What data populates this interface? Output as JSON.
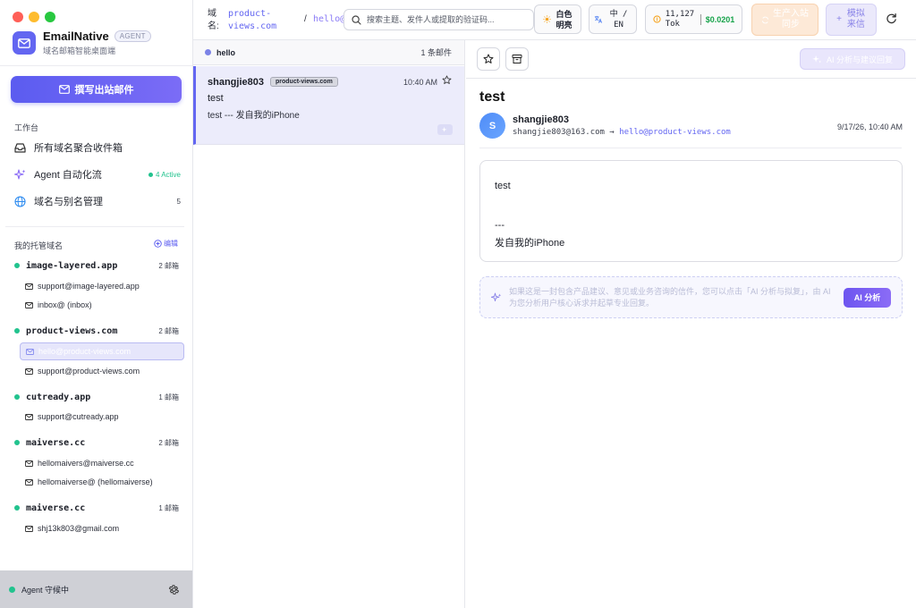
{
  "app": {
    "name": "EmailNative",
    "badge": "AGENT",
    "subtitle": "域名邮箱智能桌面端"
  },
  "sidebar": {
    "compose_label": "撰写出站邮件",
    "workspace_label": "工作台",
    "nav": [
      {
        "label": "所有域名聚合收件箱",
        "icon": "inbox-icon"
      },
      {
        "label": "Agent 自动化流",
        "icon": "sparkles-icon",
        "status": "4 Active"
      },
      {
        "label": "域名与别名管理",
        "icon": "globe-icon",
        "count": "5"
      }
    ],
    "domains_label": "我的托管域名",
    "edit_label": "编辑",
    "domains": [
      {
        "name": "image-layered.app",
        "count": "2 邮箱",
        "boxes": [
          "support@image-layered.app",
          "inbox@ (inbox)"
        ]
      },
      {
        "name": "product-views.com",
        "count": "2 邮箱",
        "boxes": [
          "hello@product-views.com",
          "support@product-views.com"
        ]
      },
      {
        "name": "cutready.app",
        "count": "1 邮箱",
        "boxes": [
          "support@cutready.app"
        ]
      },
      {
        "name": "maiverse.cc",
        "count": "2 邮箱",
        "boxes": [
          "hellomaivers@maiverse.cc",
          "hellomaiverse@ (hellomaiverse)"
        ]
      },
      {
        "name": "maiverse.cc",
        "count": "1 邮箱",
        "boxes": [
          "shj13k803@gmail.com"
        ]
      }
    ],
    "footer_status": "Agent 守候中"
  },
  "topbar": {
    "domain_label": "域名:",
    "domain_value": "product-views.com",
    "separator": "/",
    "mailbox": "hello@",
    "search_placeholder": "搜索主题、发件人或提取的验证码...",
    "theme_label": "白色明亮",
    "lang_label": "中 / EN",
    "tokens": "11,127 Tok",
    "cost": "$0.0201",
    "sync_label": "生产入站同步",
    "mock_label": "模拟来信"
  },
  "list": {
    "mailbox_name": "hello",
    "count_label": "1 条邮件",
    "messages": [
      {
        "sender": "shangjie803",
        "domain_tag": "product-views.com",
        "time": "10:40 AM",
        "subject": "test",
        "preview": "test --- 发自我的iPhone"
      }
    ]
  },
  "reader": {
    "ai_suggest_label": "AI 分析与建议回复",
    "subject": "test",
    "avatar_letter": "S",
    "from_name": "shangjie803",
    "from_email": "shangjie803@163.com",
    "arrow": "→",
    "to_email": "hello@product-views.com",
    "date": "9/17/26, 10:40 AM",
    "body_lines": [
      "test",
      "---",
      "发自我的iPhone"
    ],
    "ai_hint": "如果这是一封包含产品建议、意见或业务咨询的信件，您可以点击「AI 分析与拟复」，由 AI 为您分析用户核心诉求并起草专业回复。",
    "ai_button": "AI 分析"
  },
  "colors": {
    "accent": "#6366f1",
    "active_green": "#22c38e",
    "cost_green": "#16a34a"
  }
}
